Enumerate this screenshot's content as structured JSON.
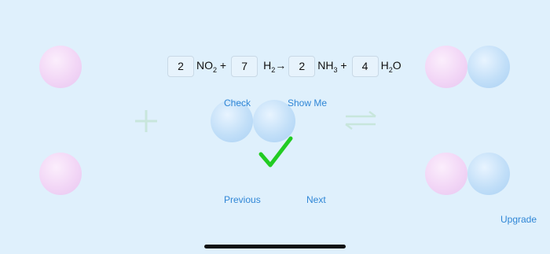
{
  "equation": {
    "coef1": "2",
    "term1": [
      "NO",
      "2",
      " +"
    ],
    "coef2": "7",
    "term2": [
      "H",
      "2",
      "→"
    ],
    "coef3": "2",
    "term3": [
      "NH",
      "3",
      " +"
    ],
    "coef4": "4",
    "term4": [
      "H",
      "2",
      "O"
    ]
  },
  "actions": {
    "check": "Check",
    "show_me": "Show Me",
    "previous": "Previous",
    "next": "Next",
    "upgrade": "Upgrade"
  },
  "icons": {
    "plus": "plus-icon",
    "equilibrium": "equilibrium-arrows-icon",
    "check": "checkmark-icon"
  },
  "colors": {
    "background": "#dff0fc",
    "link": "#2f86d6",
    "checkmark": "#22cc22"
  }
}
